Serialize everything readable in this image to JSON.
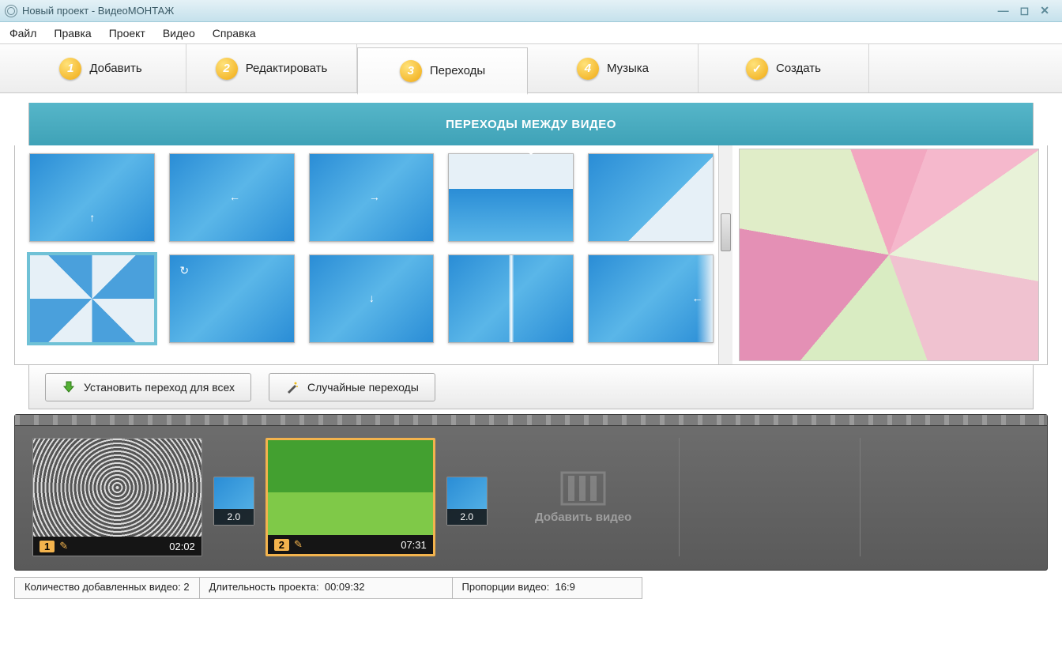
{
  "window": {
    "title": "Новый проект - ВидеоМОНТАЖ"
  },
  "menu": [
    "Файл",
    "Правка",
    "Проект",
    "Видео",
    "Справка"
  ],
  "steps": [
    {
      "num": "1",
      "label": "Добавить"
    },
    {
      "num": "2",
      "label": "Редактировать"
    },
    {
      "num": "3",
      "label": "Переходы"
    },
    {
      "num": "4",
      "label": "Музыка"
    },
    {
      "num": "✓",
      "label": "Создать",
      "check": true
    }
  ],
  "banner": "ПЕРЕХОДЫ МЕЖДУ ВИДЕО",
  "actions": {
    "set_all": "Установить переход для всех",
    "random": "Случайные переходы"
  },
  "timeline": {
    "clips": [
      {
        "index": "1",
        "duration": "02:02"
      },
      {
        "index": "2",
        "duration": "07:31"
      }
    ],
    "transition_duration": "2.0",
    "add_label": "Добавить видео"
  },
  "status": {
    "count_label": "Количество добавленных видео:",
    "count_value": "2",
    "duration_label": "Длительность проекта:",
    "duration_value": "00:09:32",
    "ratio_label": "Пропорции видео:",
    "ratio_value": "16:9"
  }
}
